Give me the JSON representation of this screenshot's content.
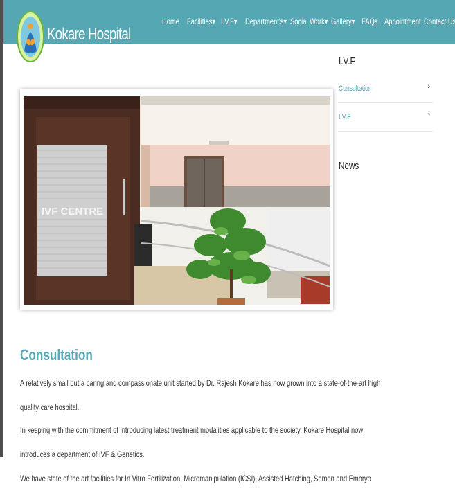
{
  "brand": {
    "name": "Kokare Hospital",
    "colors": {
      "primary": "#55a7b3",
      "dark": "#4f4f4f"
    }
  },
  "nav": {
    "items": [
      {
        "label": "Home"
      },
      {
        "label": "Facilities▾"
      },
      {
        "label": "I.V.F▾"
      },
      {
        "label": "Department's▾"
      },
      {
        "label": "Social Work▾"
      },
      {
        "label": "Gallery▾"
      },
      {
        "label": "FAQs"
      },
      {
        "label": "Appointment"
      },
      {
        "label": "Contact Us"
      }
    ]
  },
  "sidebar": {
    "title": "I.V.F",
    "links": [
      {
        "label": "Consultation",
        "icon": "chevron-right-icon"
      },
      {
        "label": "I.V.F",
        "icon": "chevron-right-icon"
      }
    ],
    "news_title": "News"
  },
  "photo": {
    "sign_text": "IVF CENTRE"
  },
  "content": {
    "title": "Consultation",
    "paragraphs": [
      [
        "A relatively small but a caring and compassionate unit started by Dr. Rajesh Kokare has now grown into a state-of-the-art high",
        "quality care hospital."
      ],
      [
        "In keeping with the commitment of introducing latest treatment modalities applicable to the society, Kokare Hospital now",
        "introduces a department of IVF & Genetics."
      ],
      [
        "We have state of the art facilities for In Vitro Fertilization, Micromanipulation (ICSI), Assisted Hatching, Semen and Embryo"
      ]
    ]
  }
}
